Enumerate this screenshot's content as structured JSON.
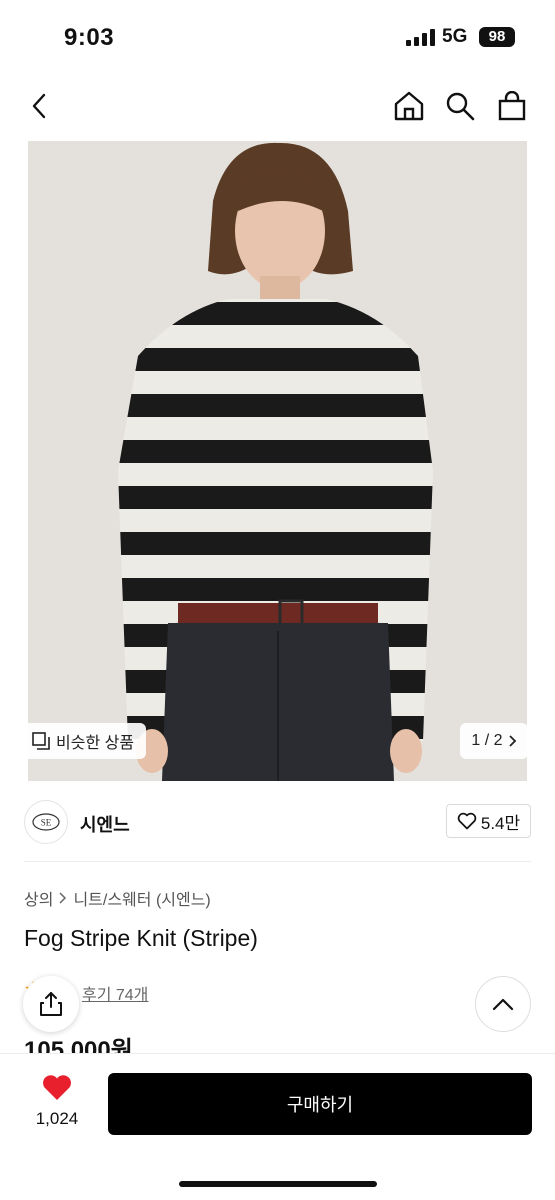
{
  "status_bar": {
    "time": "9:03",
    "network": "5G",
    "battery": "98"
  },
  "nav": {
    "back_icon": "back-arrow-icon",
    "home_icon": "home-icon",
    "search_icon": "search-icon",
    "cart_icon": "shopping-bag-icon"
  },
  "hero": {
    "image_alt": "Fog Stripe Knit (Stripe)",
    "similar_label": "비슷한 상품",
    "page_indicator": "1 / 2"
  },
  "brand": {
    "logo_text": "SE",
    "name": "시엔느",
    "like_count": "5.4만"
  },
  "breadcrumb": {
    "category": "상의",
    "subcategory": "니트/스웨터 (시엔느)"
  },
  "product": {
    "title": "Fog Stripe Knit (Stripe)",
    "review_label": "후기 74개",
    "price": "105,000원"
  },
  "bottom_bar": {
    "wish_count": "1,024",
    "buy_label": "구매하기"
  },
  "colors": {
    "accent_heart": "#e8202e",
    "buy_button": "#000000",
    "star": "#f5a623"
  }
}
